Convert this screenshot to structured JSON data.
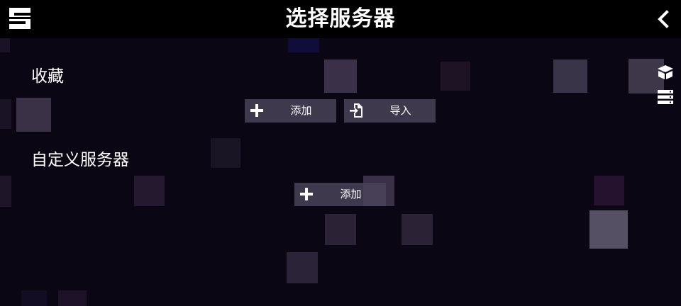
{
  "header": {
    "title": "选择服务器",
    "logo_icon": "s-logo-icon",
    "back_icon": "chevron-left-icon"
  },
  "sections": {
    "favorites": {
      "title": "收藏",
      "add_label": "添加",
      "import_label": "导入"
    },
    "custom": {
      "title": "自定义服务器",
      "add_label": "添加"
    }
  },
  "side_toolbar": {
    "icons": [
      "package-icon",
      "server-list-icon"
    ]
  },
  "colors": {
    "background": "#0b0614",
    "topbar": "#000000",
    "button": "#4a445a",
    "text": "#ffffff"
  }
}
